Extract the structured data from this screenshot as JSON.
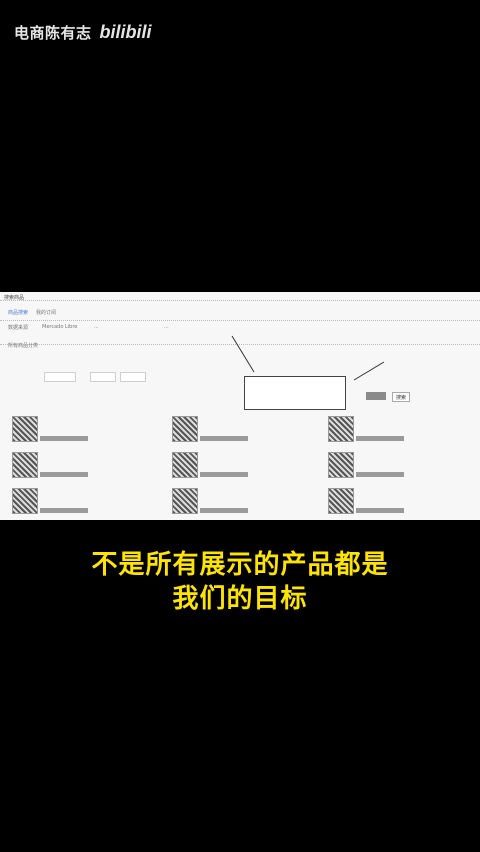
{
  "watermark": {
    "channel": "电商陈有志",
    "logo": "bilibili"
  },
  "caption": {
    "line1": "不是所有展示的产品都是",
    "line2": "我们的目标"
  },
  "screenshot": {
    "page_title": "搜索商品",
    "tabs": [
      "商品搜索",
      "我的订阅"
    ],
    "filters": [
      "数据来源",
      "Mercado Libre",
      "...",
      "..."
    ],
    "section_label": "所有商品分类",
    "search_button": "搜索"
  }
}
